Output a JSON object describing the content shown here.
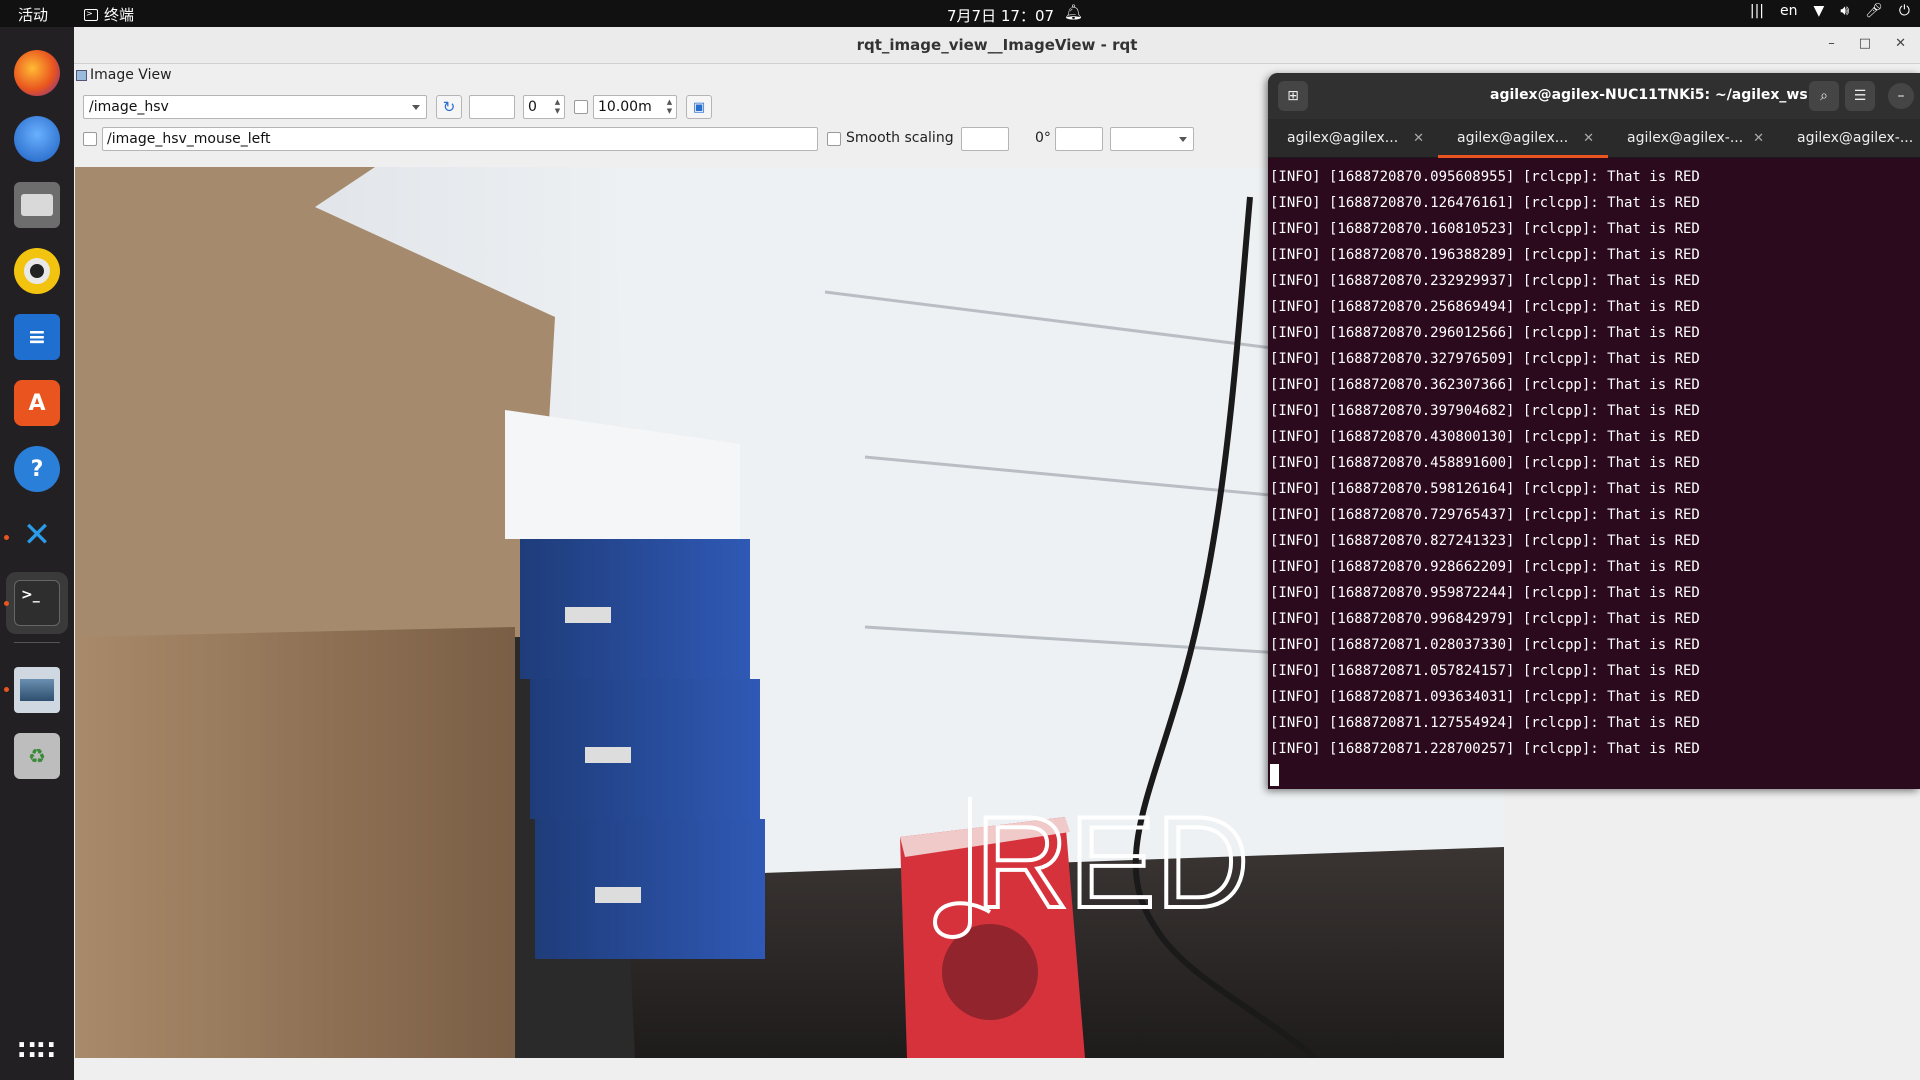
{
  "topbar": {
    "activities": "活动",
    "app_name": "终端",
    "clock": "7月7日 17：07",
    "input_lang": "en"
  },
  "rqt": {
    "title": "rqt_image_view__ImageView - rqt",
    "plugin_title": "Image View",
    "topic": "/image_hsv",
    "number_value": "0",
    "duration_value": "10.00m",
    "mouse_topic": "/image_hsv_mouse_left",
    "smooth_scaling_label": "Smooth scaling",
    "rotation_label": "0°"
  },
  "image_overlay": {
    "text": "RED"
  },
  "terminal": {
    "title": "agilex@agilex-NUC11TNKi5: ~/agilex_ws",
    "tabs": [
      {
        "label": "agilex@agilex..."
      },
      {
        "label": "agilex@agilex..."
      },
      {
        "label": "agilex@agilex-..."
      },
      {
        "label": "agilex@agilex-..."
      }
    ],
    "active_tab": 1,
    "lines": [
      "[INFO] [1688720870.095608955] [rclcpp]: That is RED",
      "[INFO] [1688720870.126476161] [rclcpp]: That is RED",
      "[INFO] [1688720870.160810523] [rclcpp]: That is RED",
      "[INFO] [1688720870.196388289] [rclcpp]: That is RED",
      "[INFO] [1688720870.232929937] [rclcpp]: That is RED",
      "[INFO] [1688720870.256869494] [rclcpp]: That is RED",
      "[INFO] [1688720870.296012566] [rclcpp]: That is RED",
      "[INFO] [1688720870.327976509] [rclcpp]: That is RED",
      "[INFO] [1688720870.362307366] [rclcpp]: That is RED",
      "[INFO] [1688720870.397904682] [rclcpp]: That is RED",
      "[INFO] [1688720870.430800130] [rclcpp]: That is RED",
      "[INFO] [1688720870.458891600] [rclcpp]: That is RED",
      "[INFO] [1688720870.598126164] [rclcpp]: That is RED",
      "[INFO] [1688720870.729765437] [rclcpp]: That is RED",
      "[INFO] [1688720870.827241323] [rclcpp]: That is RED",
      "[INFO] [1688720870.928662209] [rclcpp]: That is RED",
      "[INFO] [1688720870.959872244] [rclcpp]: That is RED",
      "[INFO] [1688720870.996842979] [rclcpp]: That is RED",
      "[INFO] [1688720871.028037330] [rclcpp]: That is RED",
      "[INFO] [1688720871.057824157] [rclcpp]: That is RED",
      "[INFO] [1688720871.093634031] [rclcpp]: That is RED",
      "[INFO] [1688720871.127554924] [rclcpp]: That is RED",
      "[INFO] [1688720871.228700257] [rclcpp]: That is RED"
    ]
  },
  "colors": {
    "ubuntu_orange": "#e95420",
    "terminal_bg": "#2c0a1e",
    "dock_bg": "#232023"
  }
}
